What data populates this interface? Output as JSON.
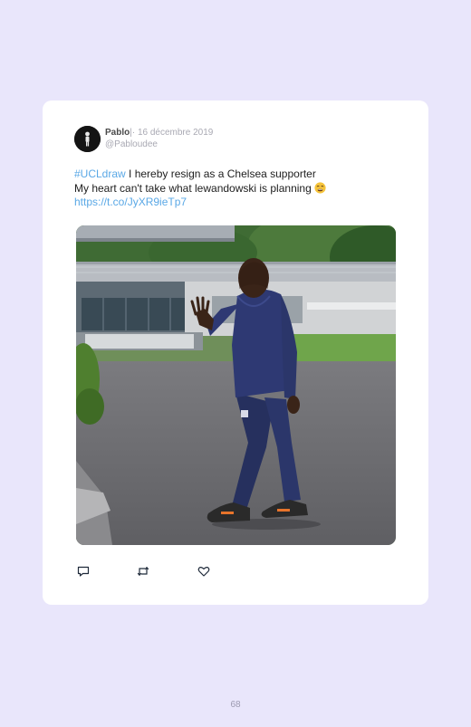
{
  "tweet": {
    "author_name": "Pablo",
    "separator": "|",
    "date": "· 16 décembre 2019",
    "handle": "@Pabloudee",
    "hashtag": "#UCLdraw",
    "line1_rest": " I hereby resign as a Chelsea supporter",
    "line2": "My heart can't take what lewandowski is planning ",
    "emoji": "weary-face-emoji",
    "link": "https://t.co/JyXR9ieTp7",
    "media_description": "photo"
  },
  "actions": [
    {
      "name": "reply",
      "icon": "speech-bubble-icon"
    },
    {
      "name": "retweet",
      "icon": "retweet-icon"
    },
    {
      "name": "like",
      "icon": "heart-icon"
    }
  ],
  "colors": {
    "page_background": "#e9e6fb",
    "card_background": "#ffffff",
    "link": "#5aa8e6",
    "muted_text": "#a9a9b3"
  },
  "page_number": "68"
}
